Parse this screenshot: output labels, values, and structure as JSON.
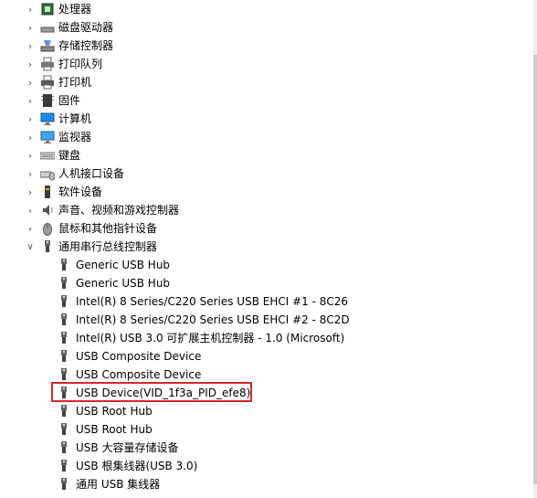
{
  "categories": [
    {
      "label": "处理器",
      "icon": "cpu-icon"
    },
    {
      "label": "磁盘驱动器",
      "icon": "disk-drive-icon"
    },
    {
      "label": "存储控制器",
      "icon": "storage-controller-icon"
    },
    {
      "label": "打印队列",
      "icon": "print-queue-icon"
    },
    {
      "label": "打印机",
      "icon": "printer-icon"
    },
    {
      "label": "固件",
      "icon": "firmware-icon"
    },
    {
      "label": "计算机",
      "icon": "computer-icon"
    },
    {
      "label": "监视器",
      "icon": "monitor-icon"
    },
    {
      "label": "键盘",
      "icon": "keyboard-icon"
    },
    {
      "label": "人机接口设备",
      "icon": "hid-icon"
    },
    {
      "label": "软件设备",
      "icon": "software-device-icon"
    },
    {
      "label": "声音、视频和游戏控制器",
      "icon": "speaker-icon"
    },
    {
      "label": "鼠标和其他指针设备",
      "icon": "mouse-icon"
    }
  ],
  "expanded_category": {
    "label": "通用串行总线控制器",
    "icon": "usb-icon"
  },
  "usb_devices": [
    "Generic USB Hub",
    "Generic USB Hub",
    "Intel(R) 8 Series/C220 Series USB EHCI #1 - 8C26",
    "Intel(R) 8 Series/C220 Series USB EHCI #2 - 8C2D",
    "Intel(R) USB 3.0 可扩展主机控制器 - 1.0 (Microsoft)",
    "USB Composite Device",
    "USB Composite Device",
    "USB Device(VID_1f3a_PID_efe8)",
    "USB Root Hub",
    "USB Root Hub",
    "USB 大容量存储设备",
    "USB 根集线器(USB 3.0)",
    "通用 USB 集线器"
  ],
  "highlighted_device": "USB Device(VID_1f3a_PID_efe8)",
  "colors": {
    "highlight_border": "#d9262b"
  }
}
